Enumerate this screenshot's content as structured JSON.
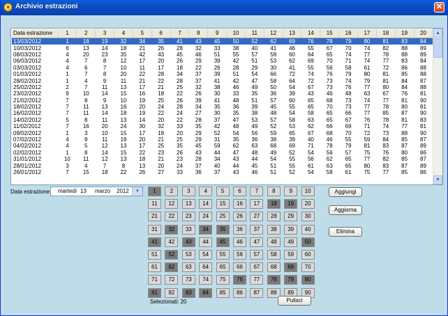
{
  "window": {
    "title": "Archivio estrazioni",
    "app_icon": "lottery-ball-icon",
    "close_icon": "close-icon"
  },
  "table": {
    "columns": [
      "Data estrazione",
      "1",
      "2",
      "3",
      "4",
      "5",
      "6",
      "7",
      "8",
      "9",
      "10",
      "11",
      "12",
      "13",
      "14",
      "15",
      "16",
      "17",
      "18",
      "19",
      "20"
    ],
    "selected_row": 0,
    "rows": [
      [
        "13/03/2012",
        1,
        18,
        19,
        32,
        34,
        35,
        41,
        43,
        45,
        50,
        52,
        62,
        69,
        76,
        78,
        79,
        80,
        81,
        83,
        84
      ],
      [
        "10/03/2012",
        6,
        13,
        14,
        18,
        21,
        26,
        28,
        32,
        33,
        38,
        40,
        41,
        46,
        55,
        67,
        70,
        74,
        82,
        88,
        89
      ],
      [
        "08/03/2012",
        4,
        20,
        23,
        35,
        42,
        43,
        45,
        46,
        51,
        55,
        57,
        58,
        60,
        64,
        65,
        74,
        77,
        78,
        88,
        89
      ],
      [
        "06/03/2012",
        4,
        7,
        8,
        12,
        17,
        20,
        26,
        29,
        39,
        42,
        51,
        53,
        62,
        69,
        70,
        71,
        74,
        77,
        83,
        84
      ],
      [
        "03/03/2012",
        4,
        6,
        7,
        10,
        11,
        17,
        18,
        22,
        26,
        28,
        29,
        30,
        41,
        55,
        56,
        58,
        61,
        72,
        86,
        88
      ],
      [
        "01/03/2012",
        1,
        7,
        8,
        20,
        22,
        28,
        34,
        37,
        39,
        51,
        54,
        66,
        72,
        74,
        76,
        79,
        80,
        81,
        85,
        88
      ],
      [
        "28/02/2012",
        1,
        4,
        9,
        11,
        21,
        22,
        28,
        37,
        41,
        42,
        47,
        58,
        64,
        72,
        73,
        74,
        79,
        81,
        84,
        87
      ],
      [
        "25/02/2012",
        2,
        7,
        11,
        13,
        17,
        21,
        25,
        32,
        38,
        46,
        49,
        50,
        54,
        67,
        73,
        76,
        77,
        80,
        84,
        88
      ],
      [
        "23/02/2012",
        9,
        10,
        14,
        15,
        16,
        18,
        22,
        26,
        30,
        33,
        35,
        36,
        39,
        43,
        46,
        48,
        63,
        67,
        76,
        81
      ],
      [
        "21/02/2012",
        7,
        8,
        9,
        10,
        19,
        25,
        26,
        39,
        41,
        48,
        51,
        57,
        60,
        65,
        68,
        73,
        74,
        77,
        81,
        90
      ],
      [
        "18/02/2012",
        7,
        11,
        13,
        16,
        20,
        24,
        28,
        34,
        35,
        36,
        39,
        45,
        55,
        65,
        70,
        73,
        77,
        78,
        80,
        81
      ],
      [
        "16/02/2012",
        7,
        11,
        14,
        18,
        19,
        22,
        24,
        27,
        30,
        35,
        38,
        48,
        54,
        58,
        65,
        66,
        77,
        85,
        87,
        90
      ],
      [
        "14/02/2012",
        5,
        8,
        11,
        13,
        14,
        20,
        22,
        28,
        37,
        47,
        53,
        57,
        58,
        63,
        65,
        67,
        76,
        78,
        81,
        83
      ],
      [
        "11/02/2012",
        7,
        16,
        20,
        24,
        30,
        32,
        33,
        35,
        42,
        48,
        49,
        52,
        53,
        62,
        66,
        69,
        71,
        74,
        77,
        81
      ],
      [
        "09/02/2012",
        1,
        3,
        10,
        15,
        17,
        18,
        20,
        29,
        52,
        54,
        56,
        59,
        65,
        67,
        68,
        70,
        72,
        73,
        88,
        90
      ],
      [
        "07/02/2012",
        4,
        9,
        11,
        19,
        20,
        21,
        25,
        29,
        31,
        35,
        36,
        38,
        39,
        40,
        46,
        55,
        59,
        84,
        85,
        87
      ],
      [
        "04/02/2012",
        4,
        5,
        12,
        13,
        17,
        25,
        35,
        45,
        59,
        62,
        63,
        68,
        69,
        71,
        78,
        79,
        81,
        83,
        87,
        89
      ],
      [
        "02/02/2012",
        1,
        8,
        14,
        15,
        22,
        23,
        26,
        43,
        44,
        47,
        48,
        49,
        52,
        54,
        56,
        57,
        75,
        76,
        80,
        86
      ],
      [
        "31/01/2012",
        10,
        11,
        12,
        13,
        18,
        21,
        23,
        28,
        34,
        43,
        44,
        54,
        55,
        56,
        62,
        65,
        77,
        82,
        85,
        87
      ],
      [
        "28/01/2012",
        3,
        4,
        7,
        8,
        13,
        20,
        24,
        37,
        40,
        44,
        45,
        51,
        55,
        61,
        63,
        65,
        80,
        83,
        87,
        89
      ],
      [
        "26/01/2012",
        7,
        15,
        18,
        22,
        26,
        27,
        33,
        36,
        37,
        43,
        46,
        51,
        52,
        54,
        58,
        61,
        75,
        77,
        85,
        86
      ]
    ]
  },
  "date_label": "Data estrazione",
  "date_picker": {
    "weekday": "martedì",
    "day": "13",
    "month": "marzo",
    "year": "2012"
  },
  "number_grid": {
    "selected": [
      1,
      18,
      19,
      32,
      34,
      35,
      41,
      43,
      45,
      50,
      52,
      62,
      69,
      76,
      78,
      79,
      80,
      81,
      83,
      84
    ]
  },
  "selected_count_text": "Selezionati: 20",
  "buttons": {
    "add": "Aggiungi",
    "update": "Aggiorna",
    "delete": "Elimina",
    "clear": "Pulisci"
  }
}
